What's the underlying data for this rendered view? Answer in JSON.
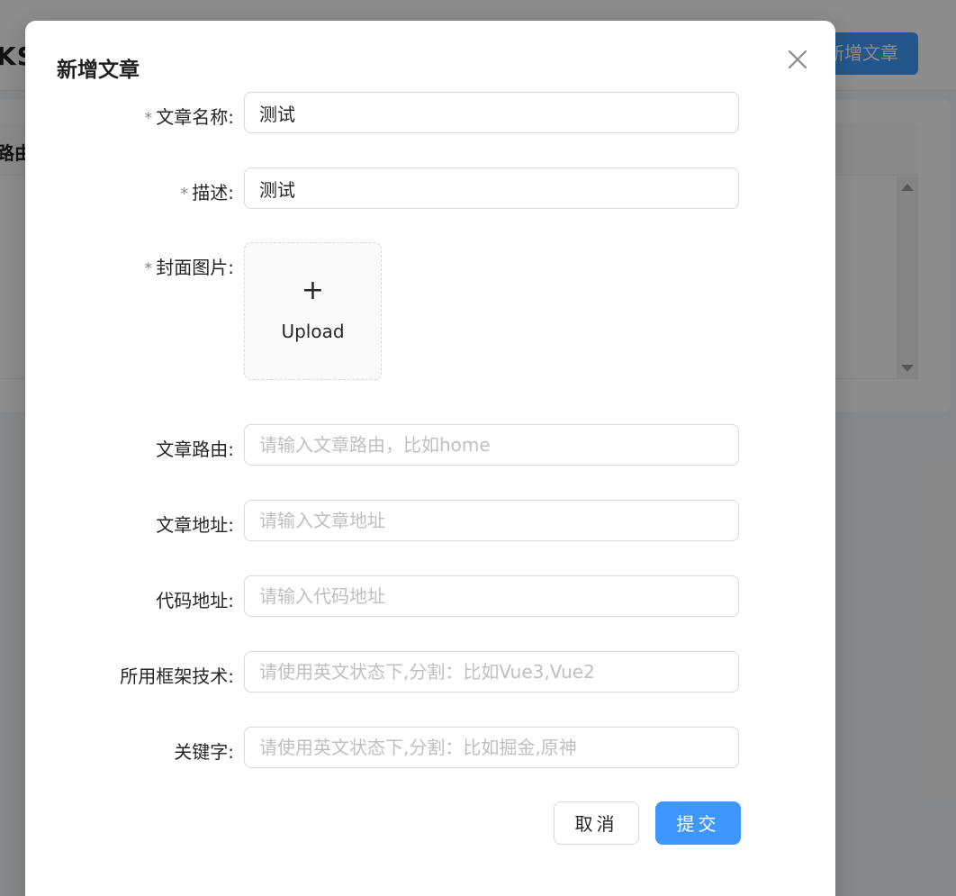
{
  "background": {
    "logo_partial": "KS",
    "add_button_partial": "新增文章",
    "column_partial": "路由"
  },
  "modal": {
    "title": "新增文章",
    "fields": {
      "name": {
        "label": "文章名称",
        "value": "测试",
        "placeholder": ""
      },
      "description": {
        "label": "描述",
        "value": "测试",
        "placeholder": ""
      },
      "cover": {
        "label": "封面图片",
        "upload_text": "Upload",
        "plus": "+"
      },
      "route": {
        "label": "文章路由",
        "value": "",
        "placeholder": "请输入文章路由，比如home"
      },
      "address": {
        "label": "文章地址",
        "value": "",
        "placeholder": "请输入文章地址"
      },
      "code": {
        "label": "代码地址",
        "value": "",
        "placeholder": "请输入代码地址"
      },
      "framework": {
        "label": "所用框架技术",
        "value": "",
        "placeholder": "请使用英文状态下,分割：比如Vue3,Vue2"
      },
      "keywords": {
        "label": "关键字",
        "value": "",
        "placeholder": "请使用英文状态下,分割：比如掘金,原神"
      }
    },
    "required_mark": "*",
    "label_colon": ":",
    "buttons": {
      "cancel": "取消",
      "submit": "提交"
    }
  },
  "colors": {
    "primary": "#4096ff",
    "border": "#d9d9d9",
    "placeholder": "#bfbfbf",
    "mask": "rgba(0,0,0,0.45)"
  },
  "icons": {
    "close": "close-icon",
    "upload": "plus-icon"
  }
}
